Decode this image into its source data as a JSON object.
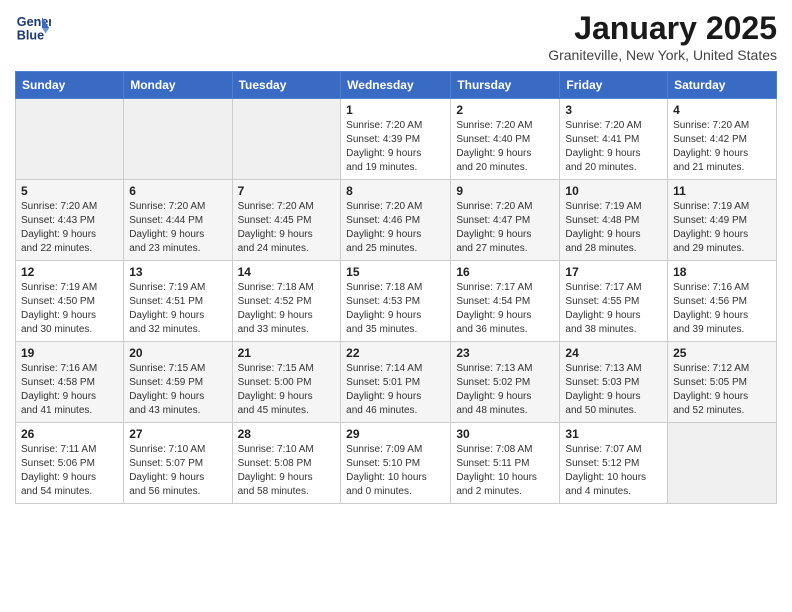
{
  "logo": {
    "line1": "General",
    "line2": "Blue"
  },
  "title": "January 2025",
  "subtitle": "Graniteville, New York, United States",
  "weekdays": [
    "Sunday",
    "Monday",
    "Tuesday",
    "Wednesday",
    "Thursday",
    "Friday",
    "Saturday"
  ],
  "weeks": [
    [
      {
        "day": "",
        "info": ""
      },
      {
        "day": "",
        "info": ""
      },
      {
        "day": "",
        "info": ""
      },
      {
        "day": "1",
        "info": "Sunrise: 7:20 AM\nSunset: 4:39 PM\nDaylight: 9 hours\nand 19 minutes."
      },
      {
        "day": "2",
        "info": "Sunrise: 7:20 AM\nSunset: 4:40 PM\nDaylight: 9 hours\nand 20 minutes."
      },
      {
        "day": "3",
        "info": "Sunrise: 7:20 AM\nSunset: 4:41 PM\nDaylight: 9 hours\nand 20 minutes."
      },
      {
        "day": "4",
        "info": "Sunrise: 7:20 AM\nSunset: 4:42 PM\nDaylight: 9 hours\nand 21 minutes."
      }
    ],
    [
      {
        "day": "5",
        "info": "Sunrise: 7:20 AM\nSunset: 4:43 PM\nDaylight: 9 hours\nand 22 minutes."
      },
      {
        "day": "6",
        "info": "Sunrise: 7:20 AM\nSunset: 4:44 PM\nDaylight: 9 hours\nand 23 minutes."
      },
      {
        "day": "7",
        "info": "Sunrise: 7:20 AM\nSunset: 4:45 PM\nDaylight: 9 hours\nand 24 minutes."
      },
      {
        "day": "8",
        "info": "Sunrise: 7:20 AM\nSunset: 4:46 PM\nDaylight: 9 hours\nand 25 minutes."
      },
      {
        "day": "9",
        "info": "Sunrise: 7:20 AM\nSunset: 4:47 PM\nDaylight: 9 hours\nand 27 minutes."
      },
      {
        "day": "10",
        "info": "Sunrise: 7:19 AM\nSunset: 4:48 PM\nDaylight: 9 hours\nand 28 minutes."
      },
      {
        "day": "11",
        "info": "Sunrise: 7:19 AM\nSunset: 4:49 PM\nDaylight: 9 hours\nand 29 minutes."
      }
    ],
    [
      {
        "day": "12",
        "info": "Sunrise: 7:19 AM\nSunset: 4:50 PM\nDaylight: 9 hours\nand 30 minutes."
      },
      {
        "day": "13",
        "info": "Sunrise: 7:19 AM\nSunset: 4:51 PM\nDaylight: 9 hours\nand 32 minutes."
      },
      {
        "day": "14",
        "info": "Sunrise: 7:18 AM\nSunset: 4:52 PM\nDaylight: 9 hours\nand 33 minutes."
      },
      {
        "day": "15",
        "info": "Sunrise: 7:18 AM\nSunset: 4:53 PM\nDaylight: 9 hours\nand 35 minutes."
      },
      {
        "day": "16",
        "info": "Sunrise: 7:17 AM\nSunset: 4:54 PM\nDaylight: 9 hours\nand 36 minutes."
      },
      {
        "day": "17",
        "info": "Sunrise: 7:17 AM\nSunset: 4:55 PM\nDaylight: 9 hours\nand 38 minutes."
      },
      {
        "day": "18",
        "info": "Sunrise: 7:16 AM\nSunset: 4:56 PM\nDaylight: 9 hours\nand 39 minutes."
      }
    ],
    [
      {
        "day": "19",
        "info": "Sunrise: 7:16 AM\nSunset: 4:58 PM\nDaylight: 9 hours\nand 41 minutes."
      },
      {
        "day": "20",
        "info": "Sunrise: 7:15 AM\nSunset: 4:59 PM\nDaylight: 9 hours\nand 43 minutes."
      },
      {
        "day": "21",
        "info": "Sunrise: 7:15 AM\nSunset: 5:00 PM\nDaylight: 9 hours\nand 45 minutes."
      },
      {
        "day": "22",
        "info": "Sunrise: 7:14 AM\nSunset: 5:01 PM\nDaylight: 9 hours\nand 46 minutes."
      },
      {
        "day": "23",
        "info": "Sunrise: 7:13 AM\nSunset: 5:02 PM\nDaylight: 9 hours\nand 48 minutes."
      },
      {
        "day": "24",
        "info": "Sunrise: 7:13 AM\nSunset: 5:03 PM\nDaylight: 9 hours\nand 50 minutes."
      },
      {
        "day": "25",
        "info": "Sunrise: 7:12 AM\nSunset: 5:05 PM\nDaylight: 9 hours\nand 52 minutes."
      }
    ],
    [
      {
        "day": "26",
        "info": "Sunrise: 7:11 AM\nSunset: 5:06 PM\nDaylight: 9 hours\nand 54 minutes."
      },
      {
        "day": "27",
        "info": "Sunrise: 7:10 AM\nSunset: 5:07 PM\nDaylight: 9 hours\nand 56 minutes."
      },
      {
        "day": "28",
        "info": "Sunrise: 7:10 AM\nSunset: 5:08 PM\nDaylight: 9 hours\nand 58 minutes."
      },
      {
        "day": "29",
        "info": "Sunrise: 7:09 AM\nSunset: 5:10 PM\nDaylight: 10 hours\nand 0 minutes."
      },
      {
        "day": "30",
        "info": "Sunrise: 7:08 AM\nSunset: 5:11 PM\nDaylight: 10 hours\nand 2 minutes."
      },
      {
        "day": "31",
        "info": "Sunrise: 7:07 AM\nSunset: 5:12 PM\nDaylight: 10 hours\nand 4 minutes."
      },
      {
        "day": "",
        "info": ""
      }
    ]
  ]
}
